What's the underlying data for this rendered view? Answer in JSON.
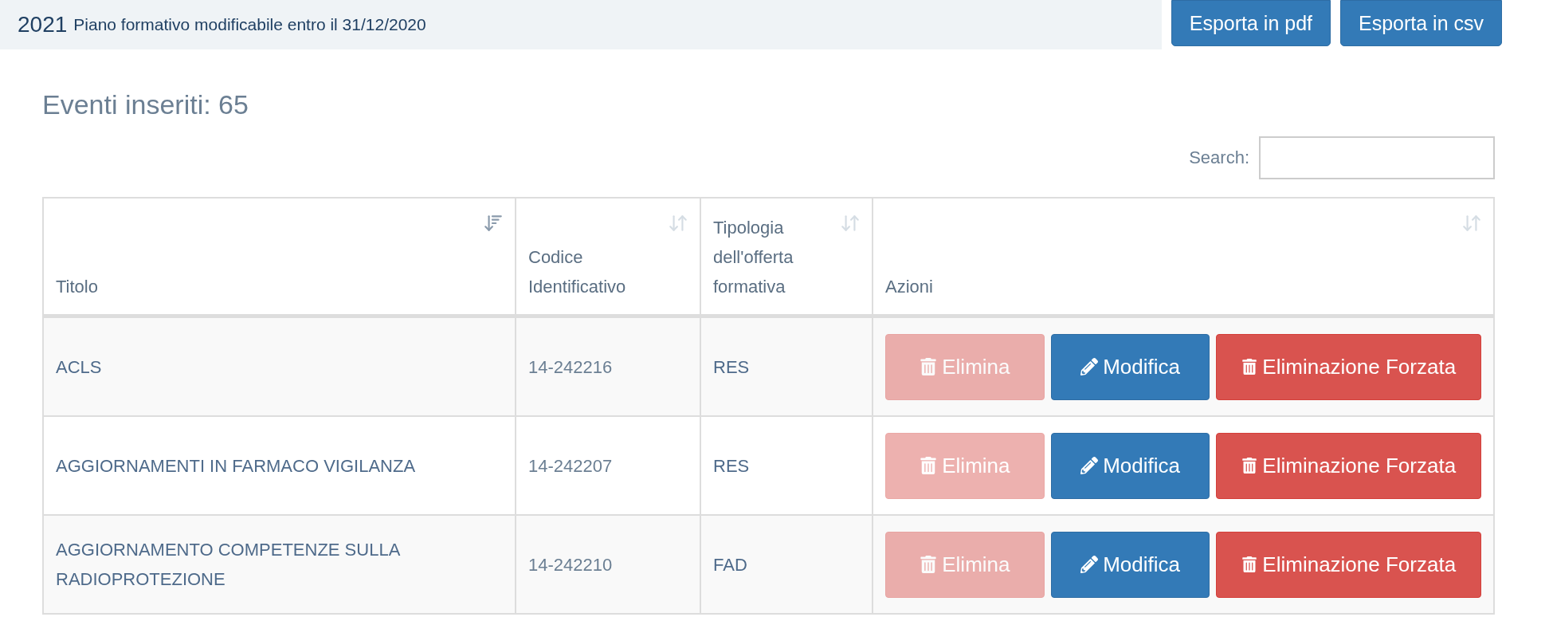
{
  "header": {
    "year": "2021",
    "subtitle": "Piano formativo modificabile entro il 31/12/2020",
    "buttons": [
      {
        "label": "Esporta in pdf"
      },
      {
        "label": "Esporta in csv"
      }
    ]
  },
  "count_title": "Eventi inseriti: 65",
  "search": {
    "label": "Search:"
  },
  "table": {
    "columns": [
      {
        "label": "Titolo",
        "sorted": true
      },
      {
        "label": "Codice Identificativo",
        "sorted": false
      },
      {
        "label": "Tipologia dell'offerta formativa",
        "sorted": false
      },
      {
        "label": "Azioni",
        "sorted": false
      }
    ],
    "rows": [
      {
        "title": "ACLS",
        "code": "14-242216",
        "type": "RES",
        "actions": [
          {
            "kind": "delete",
            "label": "Elimina",
            "disabled": true
          },
          {
            "kind": "edit",
            "label": "Modifica",
            "disabled": false
          },
          {
            "kind": "force-delete",
            "label": "Eliminazione Forzata",
            "disabled": false
          }
        ]
      },
      {
        "title": "AGGIORNAMENTI IN FARMACO VIGILANZA",
        "code": "14-242207",
        "type": "RES",
        "actions": [
          {
            "kind": "delete",
            "label": "Elimina",
            "disabled": true
          },
          {
            "kind": "edit",
            "label": "Modifica",
            "disabled": false
          },
          {
            "kind": "force-delete",
            "label": "Eliminazione Forzata",
            "disabled": false
          }
        ]
      },
      {
        "title": "AGGIORNAMENTO COMPETENZE SULLA RADIOPROTEZIONE",
        "code": "14-242210",
        "type": "FAD",
        "actions": [
          {
            "kind": "delete",
            "label": "Elimina",
            "disabled": true
          },
          {
            "kind": "edit",
            "label": "Modifica",
            "disabled": false
          },
          {
            "kind": "force-delete",
            "label": "Eliminazione Forzata",
            "disabled": false
          }
        ]
      }
    ]
  }
}
